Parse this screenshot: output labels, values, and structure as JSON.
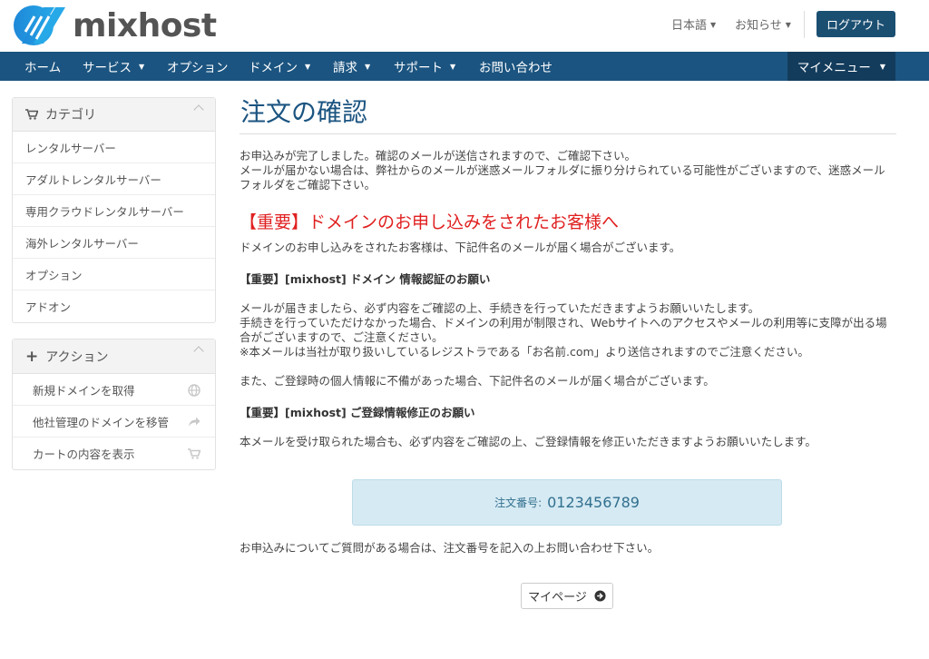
{
  "brand": {
    "logo_text": "mixhost"
  },
  "header": {
    "language": "日本語",
    "notifications": "お知らせ",
    "logout": "ログアウト"
  },
  "nav": {
    "items": [
      {
        "label": "ホーム",
        "dropdown": false
      },
      {
        "label": "サービス",
        "dropdown": true
      },
      {
        "label": "オプション",
        "dropdown": false
      },
      {
        "label": "ドメイン",
        "dropdown": true
      },
      {
        "label": "請求",
        "dropdown": true
      },
      {
        "label": "サポート",
        "dropdown": true
      },
      {
        "label": "お問い合わせ",
        "dropdown": false
      }
    ],
    "my_menu": "マイメニュー"
  },
  "sidebar": {
    "category": {
      "title": "カテゴリ",
      "items": [
        "レンタルサーバー",
        "アダルトレンタルサーバー",
        "専用クラウドレンタルサーバー",
        "海外レンタルサーバー",
        "オプション",
        "アドオン"
      ]
    },
    "actions": {
      "title": "アクション",
      "items": [
        {
          "label": "新規ドメインを取得",
          "icon": "globe-icon"
        },
        {
          "label": "他社管理のドメインを移管",
          "icon": "share-arrow-icon"
        },
        {
          "label": "カートの内容を表示",
          "icon": "cart-icon"
        }
      ]
    }
  },
  "main": {
    "title": "注文の確認",
    "intro_line1": "お申込みが完了しました。確認のメールが送信されますので、ご確認下さい。",
    "intro_line2": "メールが届かない場合は、弊社からのメールが迷惑メールフォルダに振り分けられている可能性がございますので、迷惑メールフォルダをご確認下さい。",
    "important_heading": "【重要】ドメインのお申し込みをされたお客様へ",
    "domain_note": "ドメインのお申し込みをされたお客様は、下記件名のメールが届く場合がございます。",
    "subject1": "【重要】[mixhost] ドメイン 情報認証のお願い",
    "mail1_line1": "メールが届きましたら、必ず内容をご確認の上、手続きを行っていただきますようお願いいたします。",
    "mail1_line2": "手続きを行っていただけなかった場合、ドメインの利用が制限され、Webサイトへのアクセスやメールの利用等に支障が出る場合がございますので、ご注意ください。",
    "mail1_line3": "※本メールは当社が取り扱いしているレジストラである「お名前.com」より送信されますのでご注意ください。",
    "registration_note": "また、ご登録時の個人情報に不備があった場合、下記件名のメールが届く場合がございます。",
    "subject2": "【重要】[mixhost] ご登録情報修正のお願い",
    "mail2_line1": "本メールを受け取られた場合も、必ず内容をご確認の上、ご登録情報を修正いただきますようお願いいたします。",
    "order_label": "注文番号:",
    "order_number": "0123456789",
    "contact_note": "お申込みについてご質問がある場合は、注文番号を記入の上お問い合わせ下さい。",
    "mypage_button": "マイページ"
  },
  "colors": {
    "brand_blue": "#1b5480",
    "nav_dark": "#133c5c",
    "important_red": "#e02020",
    "order_box_bg": "#d6eaf3"
  }
}
